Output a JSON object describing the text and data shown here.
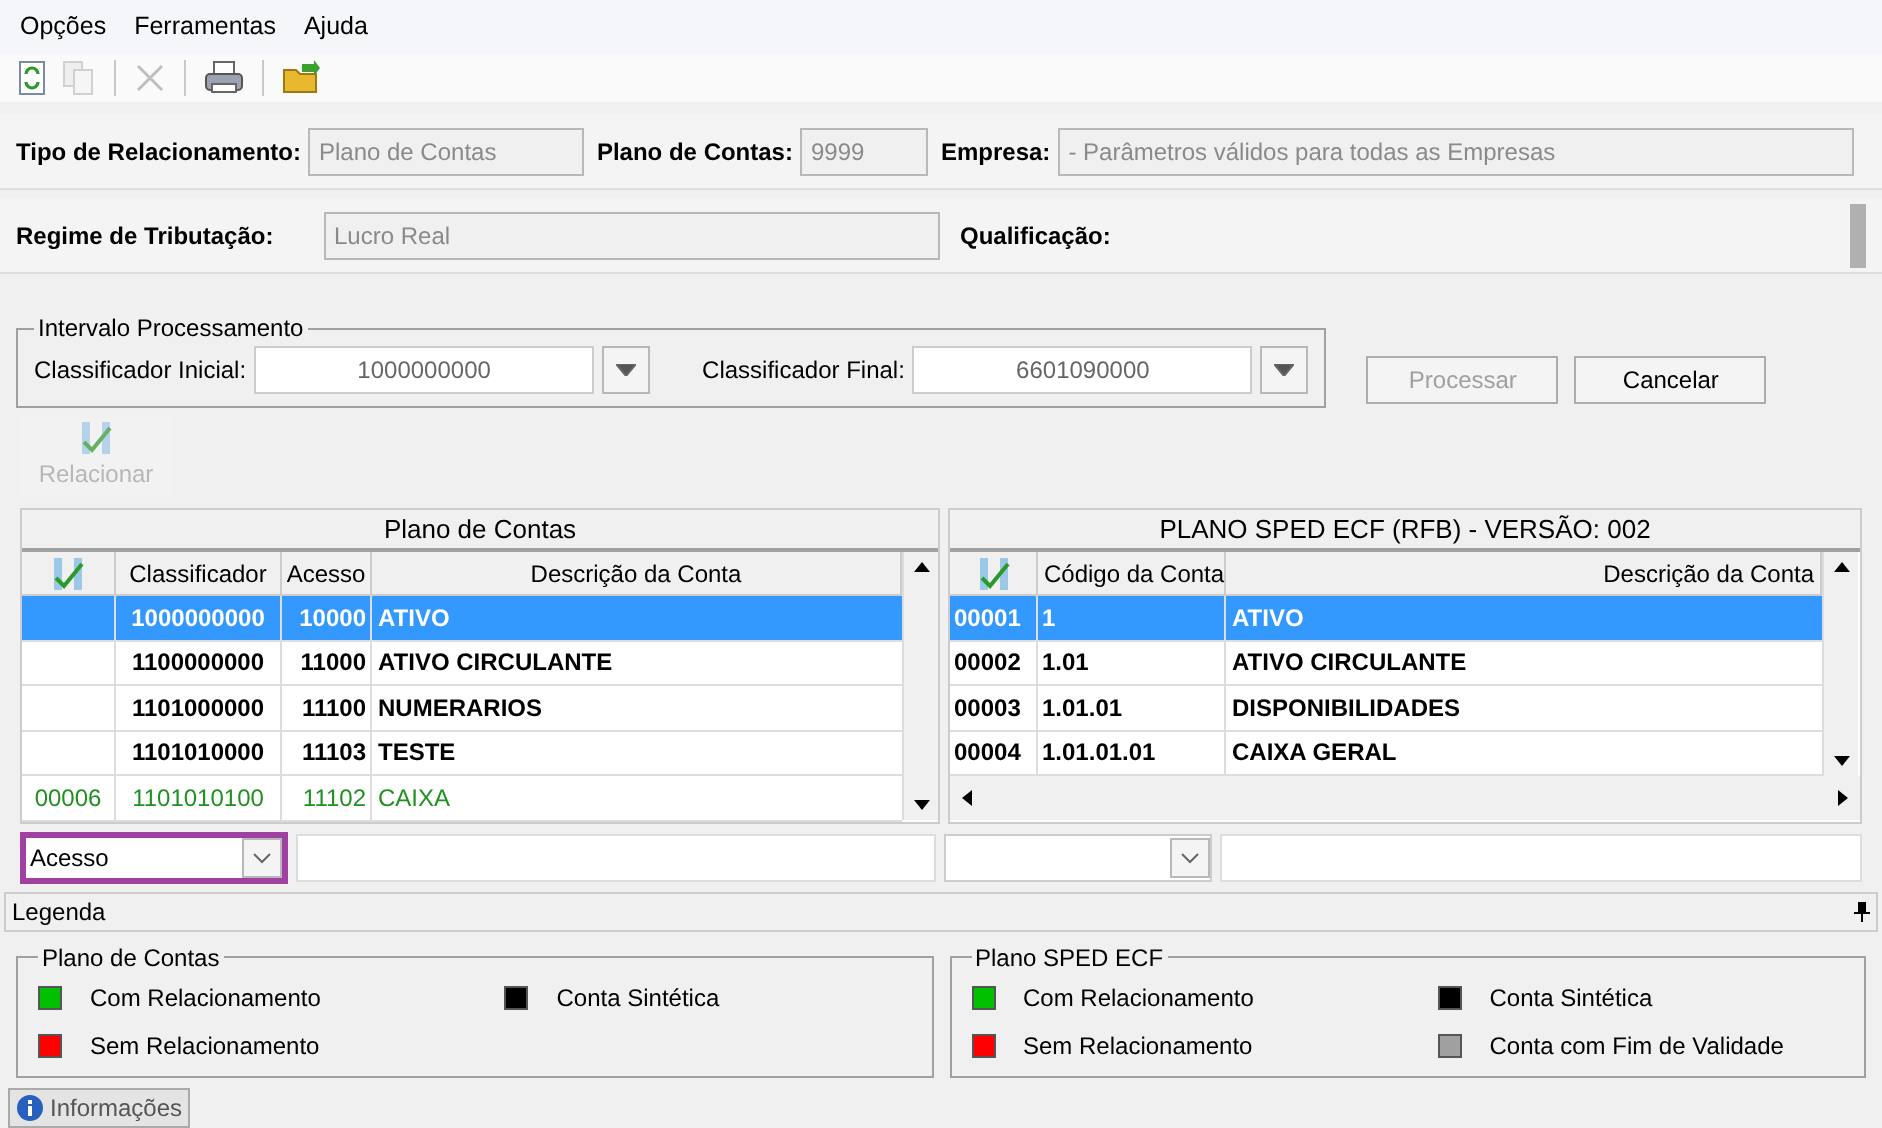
{
  "menu": [
    {
      "label": "Opções"
    },
    {
      "label": "Ferramentas"
    },
    {
      "label": "Ajuda"
    }
  ],
  "toolbar": [
    {
      "kind": "refresh",
      "disabled": false
    },
    {
      "kind": "copy",
      "disabled": true
    },
    {
      "kind": "separator"
    },
    {
      "kind": "delete",
      "disabled": true
    },
    {
      "kind": "separator"
    },
    {
      "kind": "print",
      "disabled": false
    },
    {
      "kind": "separator"
    },
    {
      "kind": "open",
      "disabled": false
    }
  ],
  "header": {
    "tipo": {
      "label": "Tipo de Relacionamento:",
      "value": "Plano de Contas",
      "disabled": true
    },
    "plano": {
      "label": "Plano de Contas:",
      "value": "9999",
      "disabled": true
    },
    "empresa": {
      "label": "Empresa:",
      "value": "- Parâmetros válidos para todas as Empresas",
      "disabled": true
    },
    "regime": {
      "label": "Regime de Tributação:",
      "value": "Lucro Real",
      "disabled": true
    },
    "qualificacao": {
      "label": "Qualificação:"
    }
  },
  "intervalo": {
    "title": "Intervalo Processamento",
    "inicial": {
      "label": "Classificador Inicial:",
      "value": "1000000000"
    },
    "final": {
      "label": "Classificador Final:",
      "value": "6601090000"
    }
  },
  "buttons": [
    {
      "label": "Processar",
      "disabled": true
    },
    {
      "label": "Cancelar",
      "disabled": false
    }
  ],
  "relacionar": {
    "label": "Relacionar",
    "disabled": true
  },
  "left_table": {
    "title": "Plano de Contas",
    "columns": [
      "Classificador",
      "Acesso",
      "Descrição da Conta"
    ],
    "rows": [
      {
        "id": "",
        "classificador": "1000000000",
        "acesso": "10000",
        "descricao": "ATIVO",
        "kind": "sintetica",
        "selected": true
      },
      {
        "id": "",
        "classificador": "1100000000",
        "acesso": "11000",
        "descricao": "ATIVO CIRCULANTE",
        "kind": "sintetica",
        "selected": false
      },
      {
        "id": "",
        "classificador": "1101000000",
        "acesso": "11100",
        "descricao": "NUMERARIOS",
        "kind": "sintetica",
        "selected": false
      },
      {
        "id": "",
        "classificador": "1101010000",
        "acesso": "11103",
        "descricao": "TESTE",
        "kind": "sintetica",
        "selected": false
      },
      {
        "id": "00006",
        "classificador": "1101010100",
        "acesso": "11102",
        "descricao": "CAIXA",
        "kind": "com_relacionamento",
        "selected": false
      }
    ]
  },
  "right_table": {
    "title": "PLANO SPED ECF (RFB) - VERSÃO: 002",
    "columns": [
      "Código da Conta",
      "Descrição da Conta"
    ],
    "rows": [
      {
        "id": "00001",
        "codigo": "1",
        "descricao": "ATIVO",
        "kind": "sintetica",
        "selected": true
      },
      {
        "id": "00002",
        "codigo": "1.01",
        "descricao": "ATIVO CIRCULANTE",
        "kind": "sintetica",
        "selected": false
      },
      {
        "id": "00003",
        "codigo": "1.01.01",
        "descricao": "DISPONIBILIDADES",
        "kind": "sintetica",
        "selected": false
      },
      {
        "id": "00004",
        "codigo": "1.01.01.01",
        "descricao": "CAIXA GERAL",
        "kind": "sintetica",
        "selected": false
      }
    ]
  },
  "left_filter": {
    "value": "Acesso",
    "highlighted": true
  },
  "right_filter": {
    "highlighted": false
  },
  "legenda": {
    "title": "Legenda",
    "groups": [
      {
        "title": "Plano de Contas",
        "items": [
          {
            "label": "Com Relacionamento",
            "color": "#00c000"
          },
          {
            "label": "Sem Relacionamento",
            "color": "#ff0000"
          },
          {
            "label": "Conta Sintética",
            "color": "#000000"
          }
        ]
      },
      {
        "title": "Plano SPED ECF",
        "items": [
          {
            "label": "Com Relacionamento",
            "color": "#00c000"
          },
          {
            "label": "Sem Relacionamento",
            "color": "#ff0000"
          },
          {
            "label": "Conta Sintética",
            "color": "#000000"
          },
          {
            "label": "Conta com Fim de Validade",
            "color": "#a0a0a0"
          }
        ]
      }
    ]
  },
  "tabs": [
    {
      "label": "Informações",
      "selected": true
    }
  ]
}
